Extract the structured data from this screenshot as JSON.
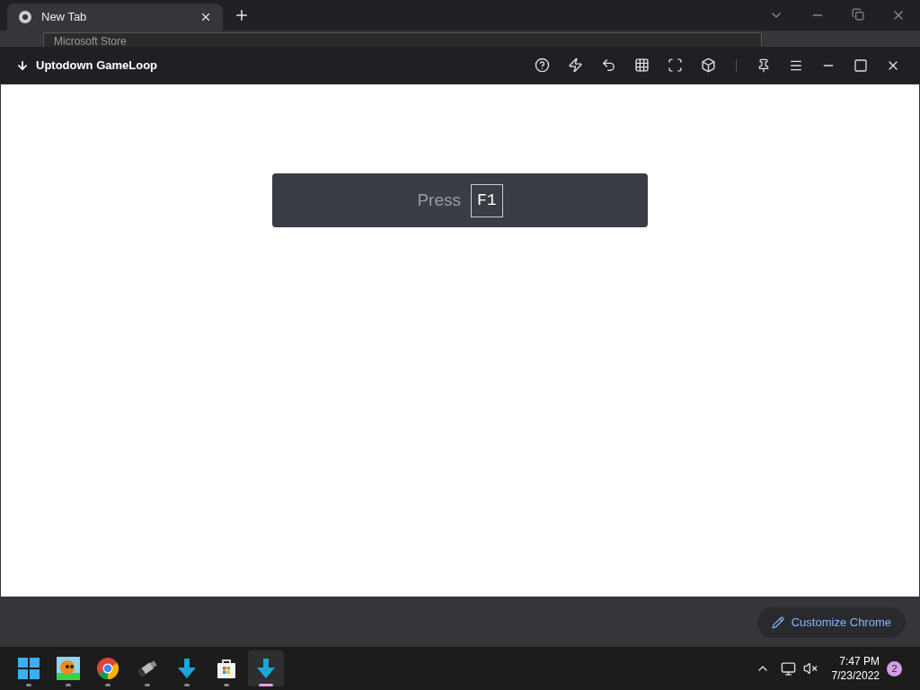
{
  "browser": {
    "tab": {
      "title": "New Tab",
      "selected": true
    },
    "behind_window": {
      "title": "Microsoft Store"
    }
  },
  "emulator": {
    "title": "Uptodown GameLoop",
    "prompt": {
      "label": "Press",
      "key": "F1"
    }
  },
  "customize_button": {
    "label": "Customize Chrome"
  },
  "taskbar": {
    "apps": [
      {
        "kind": "start",
        "selected": false
      },
      {
        "kind": "avatar",
        "selected": false
      },
      {
        "kind": "chrome",
        "selected": false
      },
      {
        "kind": "usb",
        "selected": false
      },
      {
        "kind": "uptodown",
        "selected": false
      },
      {
        "kind": "store",
        "selected": false
      },
      {
        "kind": "uptodown",
        "selected": true
      }
    ],
    "time": "7:47 PM",
    "date": "7/23/2022",
    "notifications": "2"
  }
}
